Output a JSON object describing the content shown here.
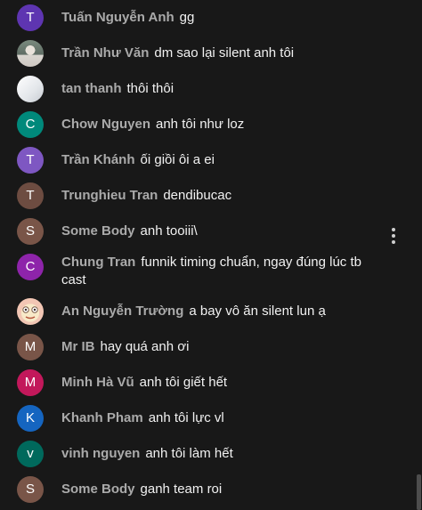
{
  "colors": {
    "background": "#181818",
    "author": "#aaaaaa",
    "text": "#f1f1f1"
  },
  "messages": [
    {
      "author": "Tuấn Nguyễn Anh",
      "text": "gg",
      "avatar_letter": "T",
      "avatar_color": "#5e35b1"
    },
    {
      "author": "Trần Như Văn",
      "text": "dm sao lại silent anh tôi",
      "avatar_letter": "",
      "avatar_color": "#6d7b72"
    },
    {
      "author": "tan thanh",
      "text": "thôi thôi",
      "avatar_letter": "",
      "avatar_color": "#e4e7eb"
    },
    {
      "author": "Chow Nguyen",
      "text": "anh tôi như loz",
      "avatar_letter": "C",
      "avatar_color": "#00897b"
    },
    {
      "author": "Trần Khánh",
      "text": "ối giồi ôi a ei",
      "avatar_letter": "T",
      "avatar_color": "#7e57c2"
    },
    {
      "author": "Trunghieu Tran",
      "text": "dendibucac",
      "avatar_letter": "T",
      "avatar_color": "#6d4c41"
    },
    {
      "author": "Some Body",
      "text": "anh tooiii\\",
      "avatar_letter": "S",
      "avatar_color": "#795548"
    },
    {
      "author": "Chung Tran",
      "text": "funnik timing chuẩn, ngay đúng lúc tb cast",
      "avatar_letter": "C",
      "avatar_color": "#8e24aa"
    },
    {
      "author": "An Nguyễn Trường",
      "text": "a bay vô ăn silent lun ạ",
      "avatar_letter": "",
      "avatar_color": "#f2c6b4"
    },
    {
      "author": "Mr IB",
      "text": "hay quá anh ơi",
      "avatar_letter": "M",
      "avatar_color": "#795548"
    },
    {
      "author": "Minh Hà Vũ",
      "text": "anh tôi giết hết",
      "avatar_letter": "M",
      "avatar_color": "#c2185b"
    },
    {
      "author": "Khanh Pham",
      "text": "anh tôi lực vl",
      "avatar_letter": "K",
      "avatar_color": "#1565c0"
    },
    {
      "author": "vinh nguyen",
      "text": "anh tôi làm hết",
      "avatar_letter": "v",
      "avatar_color": "#00695c"
    },
    {
      "author": "Some Body",
      "text": "ganh team roi",
      "avatar_letter": "S",
      "avatar_color": "#795548"
    }
  ],
  "icons": {
    "more_menu": "more-vert-icon"
  }
}
